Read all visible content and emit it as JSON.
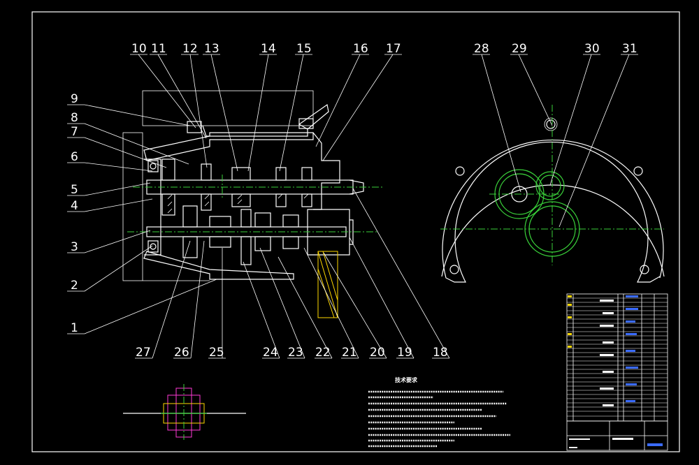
{
  "balloons": {
    "top": [
      "10",
      "11",
      "12",
      "13",
      "14",
      "15",
      "16",
      "17"
    ],
    "left": [
      "9",
      "8",
      "7",
      "6",
      "5",
      "4",
      "3",
      "2",
      "1"
    ],
    "bottom": [
      "27",
      "26",
      "25",
      "24",
      "23",
      "22",
      "21",
      "20",
      "19",
      "18"
    ],
    "right": [
      "28",
      "29",
      "30",
      "31"
    ]
  },
  "notes": {
    "title": "技术要求"
  },
  "colors": {
    "background": "#000000",
    "lines": "#ffffff",
    "centerline": "#3ad13a",
    "accent_yellow": "#ffd800",
    "accent_magenta": "#ff3ad6",
    "accent_blue": "#3a6bff"
  }
}
